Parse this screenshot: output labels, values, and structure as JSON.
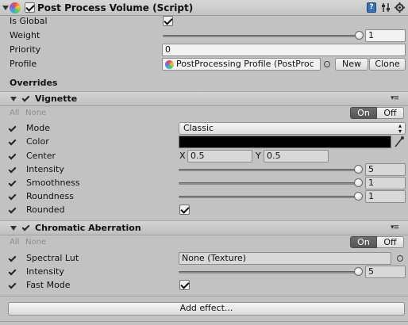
{
  "component": {
    "title": "Post Process Volume (Script)",
    "enabled": true
  },
  "fields": {
    "is_global_label": "Is Global",
    "is_global": true,
    "weight_label": "Weight",
    "weight_value": "1",
    "weight_fraction": 1.0,
    "priority_label": "Priority",
    "priority_value": "0",
    "profile_label": "Profile",
    "profile_value": "PostProcessing Profile (PostProc",
    "new_button": "New",
    "clone_button": "Clone"
  },
  "overrides_heading": "Overrides",
  "vignette": {
    "title": "Vignette",
    "all_label": "All",
    "none_label": "None",
    "on_label": "On",
    "off_label": "Off",
    "mode_label": "Mode",
    "mode_value": "Classic",
    "color_label": "Color",
    "color_value": "#000000",
    "center_label": "Center",
    "center_x_label": "X",
    "center_x": "0.5",
    "center_y_label": "Y",
    "center_y": "0.5",
    "intensity_label": "Intensity",
    "intensity_value": "5",
    "intensity_fraction": 1.0,
    "smoothness_label": "Smoothness",
    "smoothness_value": "1",
    "smoothness_fraction": 1.0,
    "roundness_label": "Roundness",
    "roundness_value": "1",
    "roundness_fraction": 1.0,
    "rounded_label": "Rounded",
    "rounded": true
  },
  "chromatic": {
    "title": "Chromatic Aberration",
    "all_label": "All",
    "none_label": "None",
    "on_label": "On",
    "off_label": "Off",
    "spectral_label": "Spectral Lut",
    "spectral_value": "None (Texture)",
    "intensity_label": "Intensity",
    "intensity_value": "5",
    "intensity_fraction": 1.0,
    "fast_mode_label": "Fast Mode",
    "fast_mode": true
  },
  "add_effect_button": "Add effect...",
  "icons": {
    "component": "post-process-icon",
    "help": "help-book-icon",
    "preset": "preset-sliders-icon",
    "settings": "gear-icon",
    "picker": "eyedropper-icon",
    "object_picker": "object-picker-circle-icon",
    "dropdown": "updown-arrows-icon",
    "section_menu": "section-menu-icon"
  },
  "colors": {
    "toggle_on_bg": "#5f5f5f",
    "panel_bg": "#c2c2c2"
  }
}
